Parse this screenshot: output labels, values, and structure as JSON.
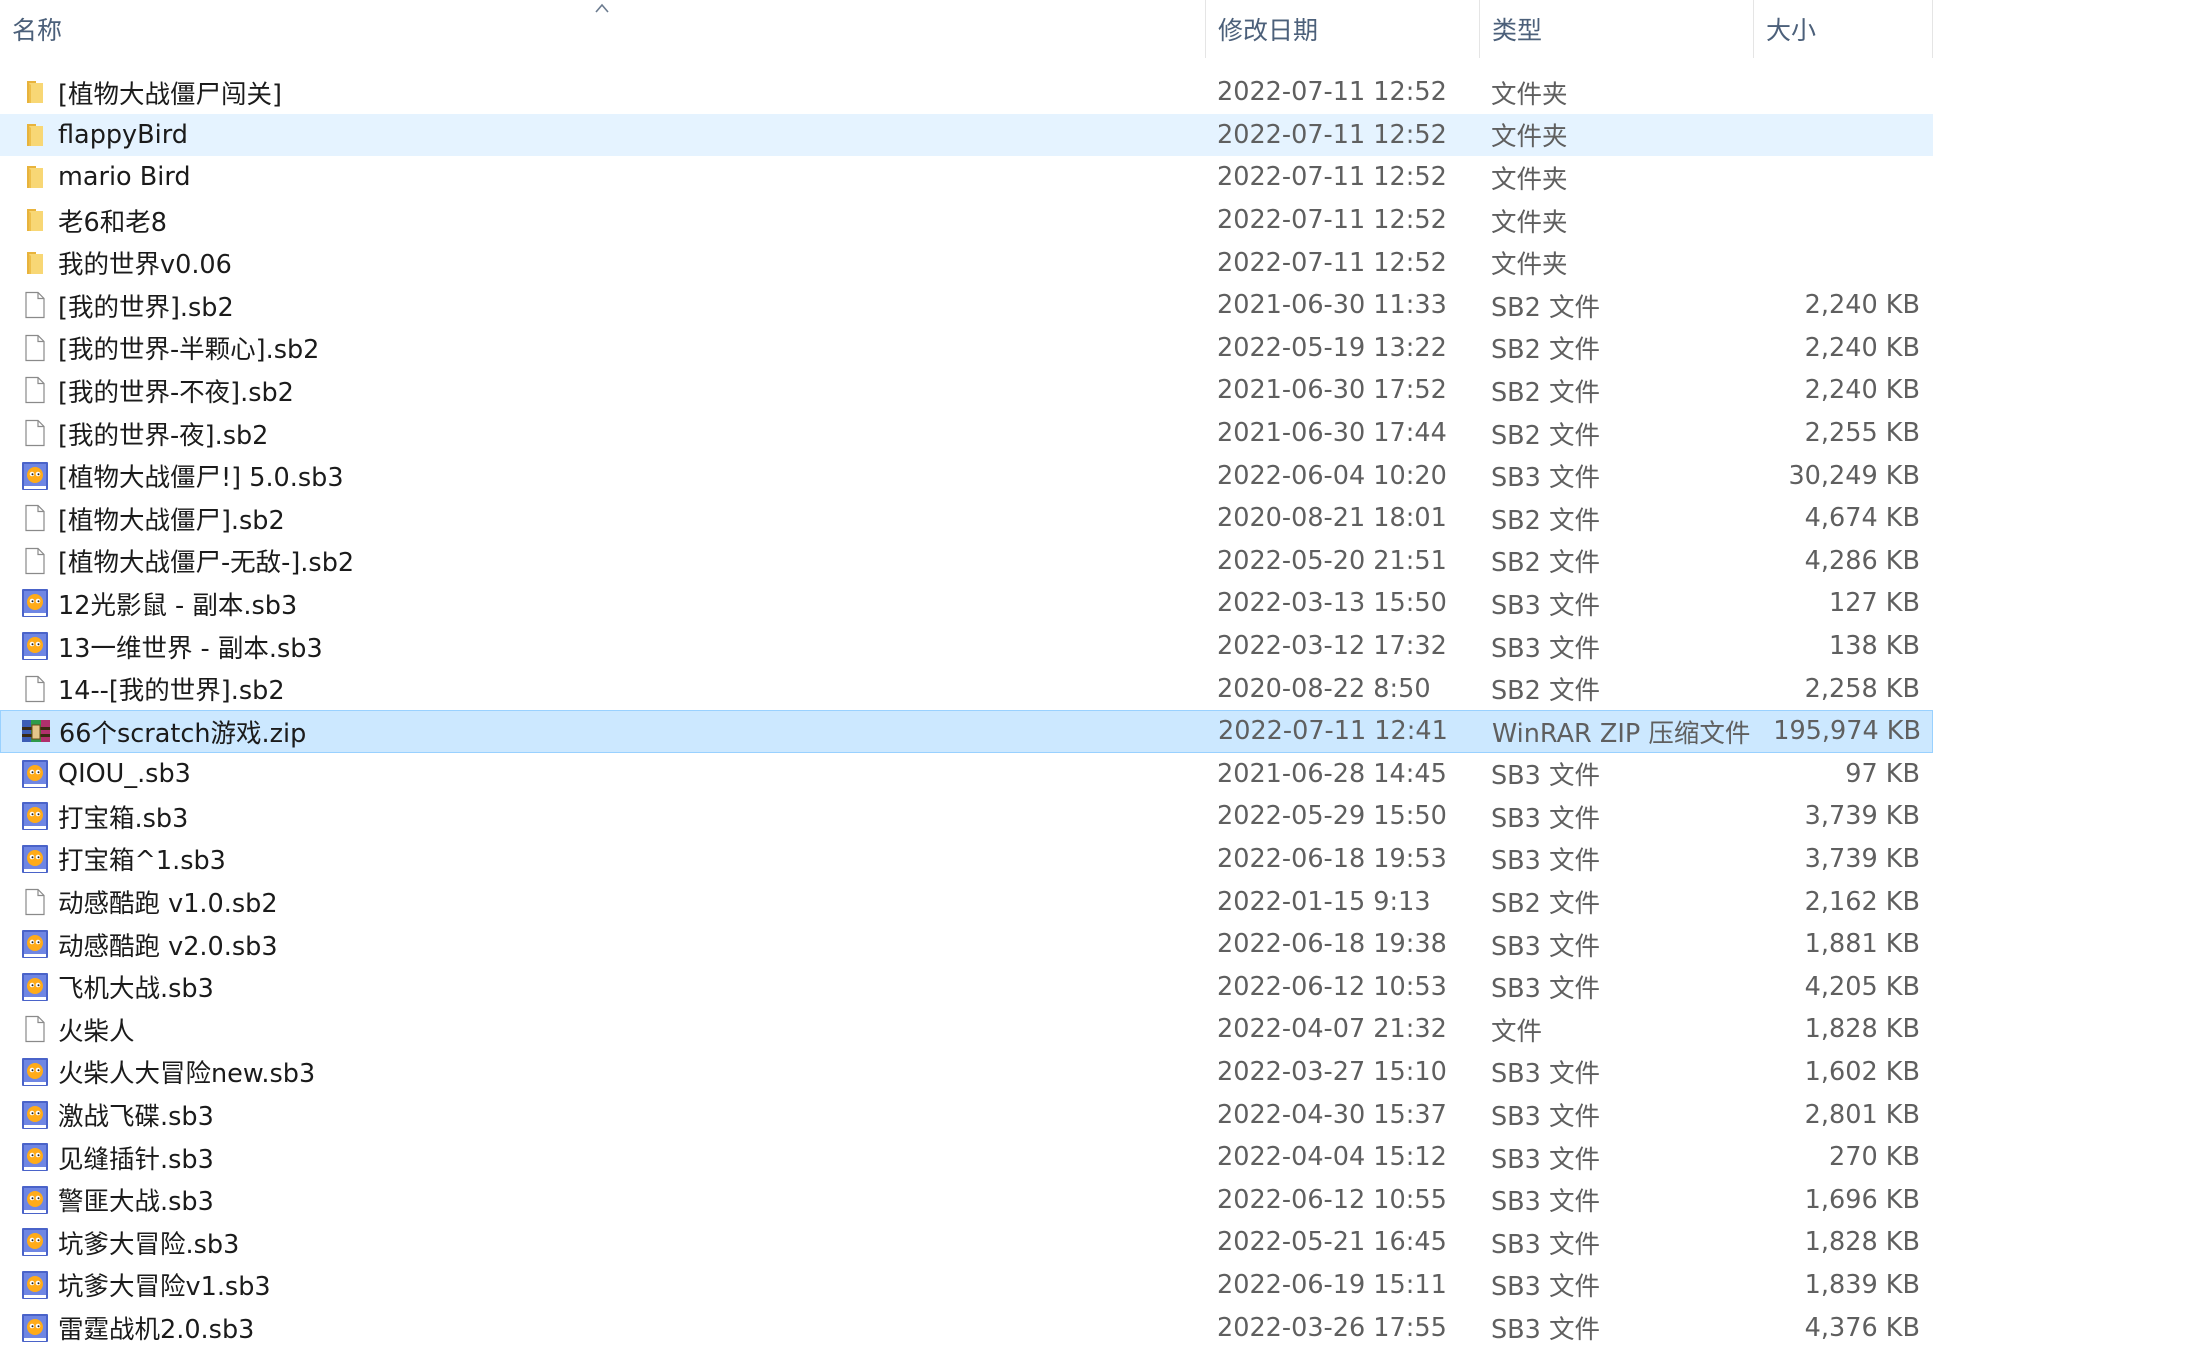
{
  "columns": {
    "name": "名称",
    "modified": "修改日期",
    "type": "类型",
    "size": "大小"
  },
  "colors": {
    "selected_bg": "#cce8ff",
    "selected_border": "#99d1ff",
    "hover_bg": "#e5f3ff",
    "header_text": "#4c607a",
    "folder_yellow": "#f8d775"
  },
  "files": [
    {
      "name": "[植物大战僵尸闯关]",
      "modified": "2022-07-11 12:52",
      "type": "文件夹",
      "size": "",
      "icon": "folder-icon",
      "state": ""
    },
    {
      "name": "flappyBird",
      "modified": "2022-07-11 12:52",
      "type": "文件夹",
      "size": "",
      "icon": "folder-icon",
      "state": "hover"
    },
    {
      "name": "mario Bird",
      "modified": "2022-07-11 12:52",
      "type": "文件夹",
      "size": "",
      "icon": "folder-icon",
      "state": ""
    },
    {
      "name": "老6和老8",
      "modified": "2022-07-11 12:52",
      "type": "文件夹",
      "size": "",
      "icon": "folder-icon",
      "state": ""
    },
    {
      "name": "我的世界v0.06",
      "modified": "2022-07-11 12:52",
      "type": "文件夹",
      "size": "",
      "icon": "folder-icon",
      "state": ""
    },
    {
      "name": "[我的世界].sb2",
      "modified": "2021-06-30 11:33",
      "type": "SB2 文件",
      "size": "2,240 KB",
      "icon": "blank-file-icon",
      "state": ""
    },
    {
      "name": "[我的世界-半颗心].sb2",
      "modified": "2022-05-19 13:22",
      "type": "SB2 文件",
      "size": "2,240 KB",
      "icon": "blank-file-icon",
      "state": ""
    },
    {
      "name": "[我的世界-不夜].sb2",
      "modified": "2021-06-30 17:52",
      "type": "SB2 文件",
      "size": "2,240 KB",
      "icon": "blank-file-icon",
      "state": ""
    },
    {
      "name": "[我的世界-夜].sb2",
      "modified": "2021-06-30 17:44",
      "type": "SB2 文件",
      "size": "2,255 KB",
      "icon": "blank-file-icon",
      "state": ""
    },
    {
      "name": "[植物大战僵尸!] 5.0.sb3",
      "modified": "2022-06-04 10:20",
      "type": "SB3 文件",
      "size": "30,249 KB",
      "icon": "scratch-file-icon",
      "state": ""
    },
    {
      "name": "[植物大战僵尸].sb2",
      "modified": "2020-08-21 18:01",
      "type": "SB2 文件",
      "size": "4,674 KB",
      "icon": "blank-file-icon",
      "state": ""
    },
    {
      "name": "[植物大战僵尸-无敌-].sb2",
      "modified": "2022-05-20 21:51",
      "type": "SB2 文件",
      "size": "4,286 KB",
      "icon": "blank-file-icon",
      "state": ""
    },
    {
      "name": "12光影鼠 - 副本.sb3",
      "modified": "2022-03-13 15:50",
      "type": "SB3 文件",
      "size": "127 KB",
      "icon": "scratch-file-icon",
      "state": ""
    },
    {
      "name": "13一维世界 - 副本.sb3",
      "modified": "2022-03-12 17:32",
      "type": "SB3 文件",
      "size": "138 KB",
      "icon": "scratch-file-icon",
      "state": ""
    },
    {
      "name": "14--[我的世界].sb2",
      "modified": "2020-08-22 8:50",
      "type": "SB2 文件",
      "size": "2,258 KB",
      "icon": "blank-file-icon",
      "state": ""
    },
    {
      "name": "66个scratch游戏.zip",
      "modified": "2022-07-11 12:41",
      "type": "WinRAR ZIP 压缩文件",
      "size": "195,974 KB",
      "icon": "winrar-archive-icon",
      "state": "selected"
    },
    {
      "name": "QIOU_.sb3",
      "modified": "2021-06-28 14:45",
      "type": "SB3 文件",
      "size": "97 KB",
      "icon": "scratch-file-icon",
      "state": ""
    },
    {
      "name": "打宝箱.sb3",
      "modified": "2022-05-29 15:50",
      "type": "SB3 文件",
      "size": "3,739 KB",
      "icon": "scratch-file-icon",
      "state": ""
    },
    {
      "name": "打宝箱^1.sb3",
      "modified": "2022-06-18 19:53",
      "type": "SB3 文件",
      "size": "3,739 KB",
      "icon": "scratch-file-icon",
      "state": ""
    },
    {
      "name": "动感酷跑 v1.0.sb2",
      "modified": "2022-01-15 9:13",
      "type": "SB2 文件",
      "size": "2,162 KB",
      "icon": "blank-file-icon",
      "state": ""
    },
    {
      "name": "动感酷跑 v2.0.sb3",
      "modified": "2022-06-18 19:38",
      "type": "SB3 文件",
      "size": "1,881 KB",
      "icon": "scratch-file-icon",
      "state": ""
    },
    {
      "name": "飞机大战.sb3",
      "modified": "2022-06-12 10:53",
      "type": "SB3 文件",
      "size": "4,205 KB",
      "icon": "scratch-file-icon",
      "state": ""
    },
    {
      "name": "火柴人",
      "modified": "2022-04-07 21:32",
      "type": "文件",
      "size": "1,828 KB",
      "icon": "blank-file-icon",
      "state": ""
    },
    {
      "name": "火柴人大冒险new.sb3",
      "modified": "2022-03-27 15:10",
      "type": "SB3 文件",
      "size": "1,602 KB",
      "icon": "scratch-file-icon",
      "state": ""
    },
    {
      "name": "激战飞碟.sb3",
      "modified": "2022-04-30 15:37",
      "type": "SB3 文件",
      "size": "2,801 KB",
      "icon": "scratch-file-icon",
      "state": ""
    },
    {
      "name": "见缝插针.sb3",
      "modified": "2022-04-04 15:12",
      "type": "SB3 文件",
      "size": "270 KB",
      "icon": "scratch-file-icon",
      "state": ""
    },
    {
      "name": "警匪大战.sb3",
      "modified": "2022-06-12 10:55",
      "type": "SB3 文件",
      "size": "1,696 KB",
      "icon": "scratch-file-icon",
      "state": ""
    },
    {
      "name": "坑爹大冒险.sb3",
      "modified": "2022-05-21 16:45",
      "type": "SB3 文件",
      "size": "1,828 KB",
      "icon": "scratch-file-icon",
      "state": ""
    },
    {
      "name": "坑爹大冒险v1.sb3",
      "modified": "2022-06-19 15:11",
      "type": "SB3 文件",
      "size": "1,839 KB",
      "icon": "scratch-file-icon",
      "state": ""
    },
    {
      "name": "雷霆战机2.0.sb3",
      "modified": "2022-03-26 17:55",
      "type": "SB3 文件",
      "size": "4,376 KB",
      "icon": "scratch-file-icon",
      "state": ""
    }
  ]
}
